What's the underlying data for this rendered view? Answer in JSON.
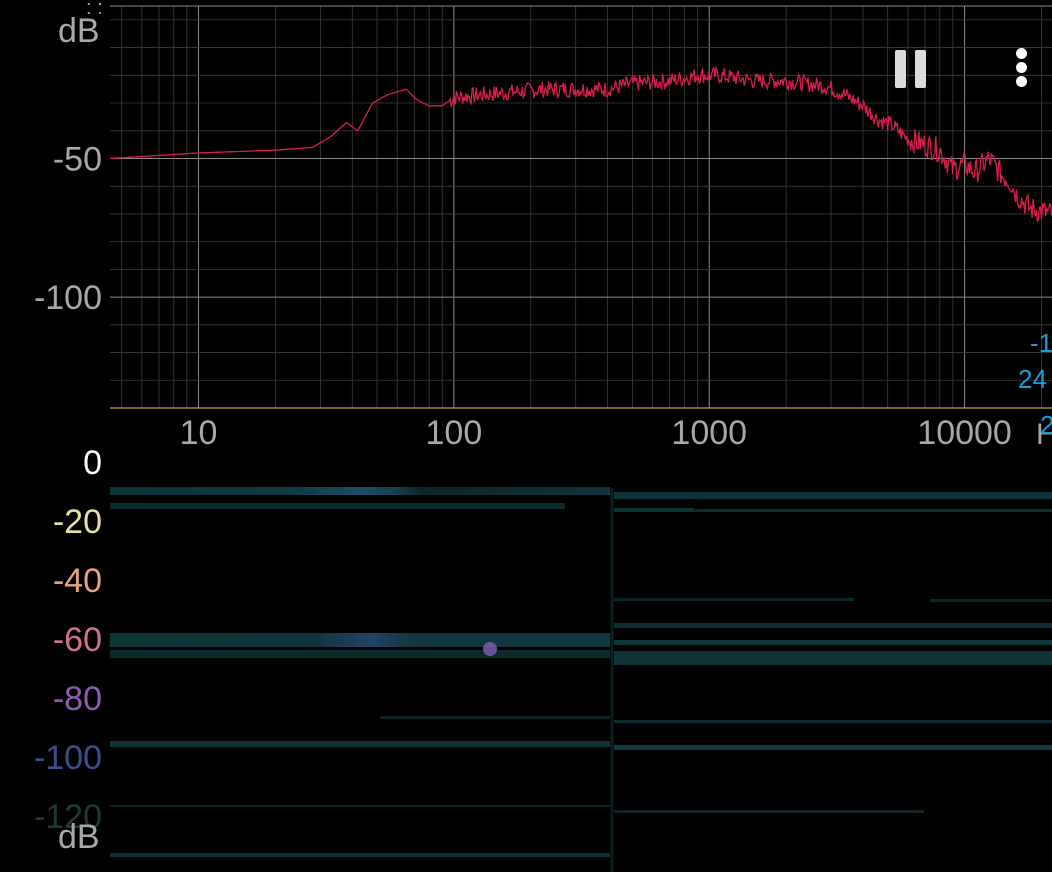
{
  "spectrum": {
    "y_unit": "dB",
    "y_ticks": [
      "-50",
      "-100"
    ],
    "x_ticks": [
      "10",
      "100",
      "1000",
      "10000"
    ],
    "x_unit_partial": "H",
    "trace_color": "#d81e48",
    "grid_color": "#3c3c3c",
    "baseline_color": "#c9a227"
  },
  "cursor_readout": {
    "line1": "-1",
    "line2": "24",
    "line3": "2"
  },
  "spectrogram": {
    "db_labels": [
      "0",
      "-20",
      "-40",
      "-60",
      "-80",
      "-100",
      "-120"
    ],
    "db_label_colors": [
      "#ffffff",
      "#e6e2a6",
      "#e6a47e",
      "#d17094",
      "#8d5cb0",
      "#3c4f8a",
      "#1d3b33"
    ],
    "y_unit": "dB"
  },
  "controls": {
    "pause_icon": "pause-icon",
    "menu_icon": "more-vertical-icon"
  },
  "chart_data": {
    "type": "line",
    "x_scale": "log",
    "xlim": [
      4.5,
      22000
    ],
    "ylim": [
      -140,
      5
    ],
    "ylabel": "dB",
    "x_ticks": [
      10,
      100,
      1000,
      10000
    ],
    "y_ticks": [
      -50,
      -100
    ],
    "series": [
      {
        "x": [
          4.5,
          10,
          20,
          28,
          33,
          38,
          42,
          48,
          55,
          65,
          72,
          80,
          90,
          100,
          130,
          170,
          230,
          300,
          400,
          500,
          700,
          900,
          1100,
          1500,
          2000,
          2400,
          2900,
          3400,
          4000,
          4600,
          5200,
          6000,
          7000,
          8000,
          9000,
          10000,
          11000,
          12500,
          14000,
          15000,
          16000,
          18000,
          22000
        ],
        "y": [
          -50,
          -48,
          -47,
          -46,
          -42,
          -37,
          -40,
          -30,
          -27,
          -25,
          -29,
          -31,
          -31,
          -28,
          -27,
          -26,
          -25,
          -25,
          -25,
          -23,
          -22,
          -20,
          -20,
          -22,
          -22,
          -23,
          -24,
          -27,
          -31,
          -36,
          -38,
          -43,
          -45,
          -47,
          -54,
          -52,
          -55,
          -50,
          -56,
          -58,
          -63,
          -68,
          -70
        ]
      }
    ]
  }
}
